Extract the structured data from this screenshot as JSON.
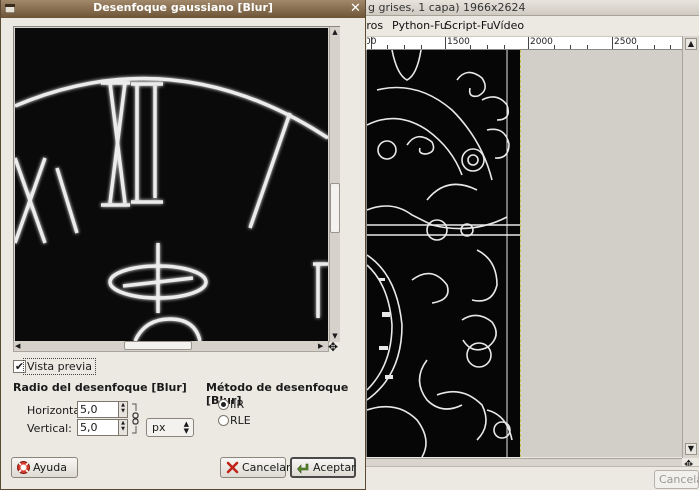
{
  "background_window": {
    "title": "g grises, 1 capa) 1966x2624",
    "menu": [
      "tros",
      "Python-Fu",
      "Script-Fu",
      "Vídeo"
    ],
    "ruler_numbers": [
      "00",
      "1500",
      "2000",
      "2500"
    ],
    "cancel_label": "Cancelar"
  },
  "dialog": {
    "title": "Desenfoque gaussiano [Blur]",
    "preview_label": "Vista previa",
    "preview_checked": true,
    "radius_heading": "Radio del desenfoque [Blur]",
    "horizontal_label": "Horizontal:",
    "horizontal_value": "5,0",
    "vertical_label": "Vertical:",
    "vertical_value": "5,0",
    "unit": "px",
    "method_heading": "Método de desenfoque [Blur]",
    "methods": [
      {
        "label": "IIR",
        "selected": true
      },
      {
        "label": "RLE",
        "selected": false
      }
    ],
    "help_label": "Ayuda",
    "cancel_label": "Cancelar",
    "ok_label": "Aceptar"
  },
  "preview_numerals": [
    "XII",
    "I",
    "X"
  ],
  "colors": {
    "titlebar": "#6d5436",
    "image_bg": "#0a0a0a",
    "edge_glow": "#f0f0f0"
  }
}
